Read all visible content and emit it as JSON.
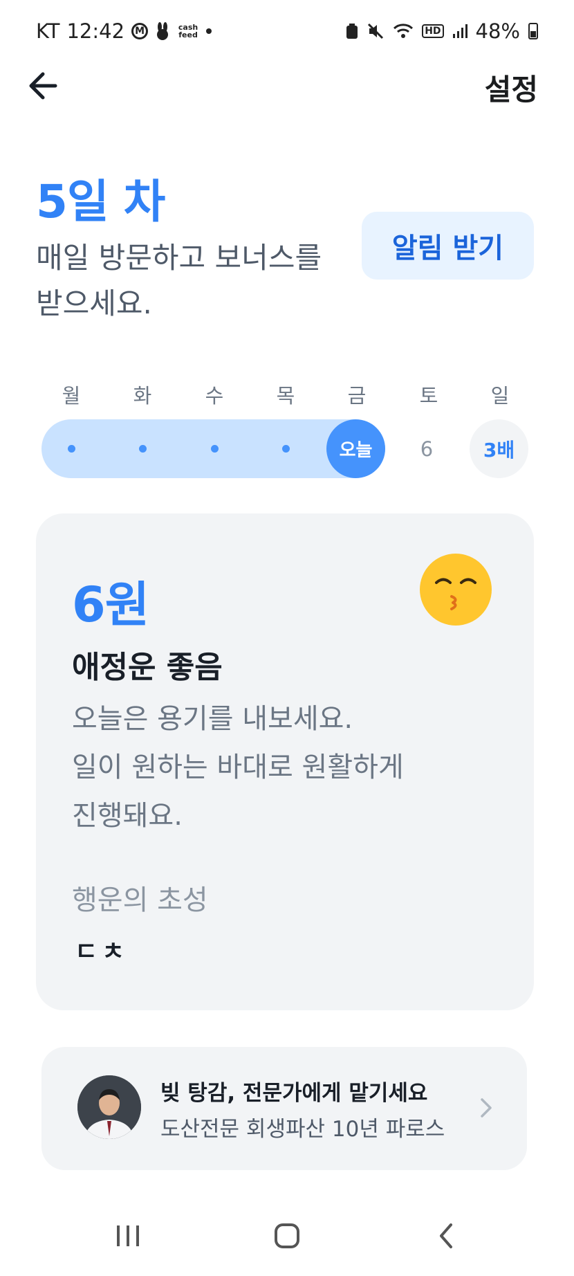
{
  "status_bar": {
    "carrier": "KT",
    "time": "12:42",
    "app_icon_text": "cash feed",
    "battery": "48%"
  },
  "header": {
    "settings_label": "설정"
  },
  "attendance": {
    "day_title": "5일 차",
    "description": "매일 방문하고 보너스를 받으세요.",
    "notify_button": "알림 받기",
    "days": [
      "월",
      "화",
      "수",
      "목",
      "금",
      "토",
      "일"
    ],
    "today_label": "오늘",
    "saturday_value": "6",
    "sunday_value": "3배",
    "completed_days": 4
  },
  "fortune": {
    "amount": "6원",
    "title": "애정운 좋음",
    "line1": "오늘은 용기를 내보세요.",
    "line2": "일이 원하는 바대로 원활하게",
    "line3": "진행돼요.",
    "lucky_label": "행운의 초성",
    "lucky_value": "ㄷㅊ",
    "emoji_icon": "kissing-face-icon"
  },
  "ad": {
    "title": "빚 탕감, 전문가에게 맡기세요",
    "subtitle": "도산전문 회생파산 10년 파로스"
  },
  "colors": {
    "accent": "#3182f6",
    "track": "#c9e2ff",
    "card_bg": "#f2f4f6"
  }
}
